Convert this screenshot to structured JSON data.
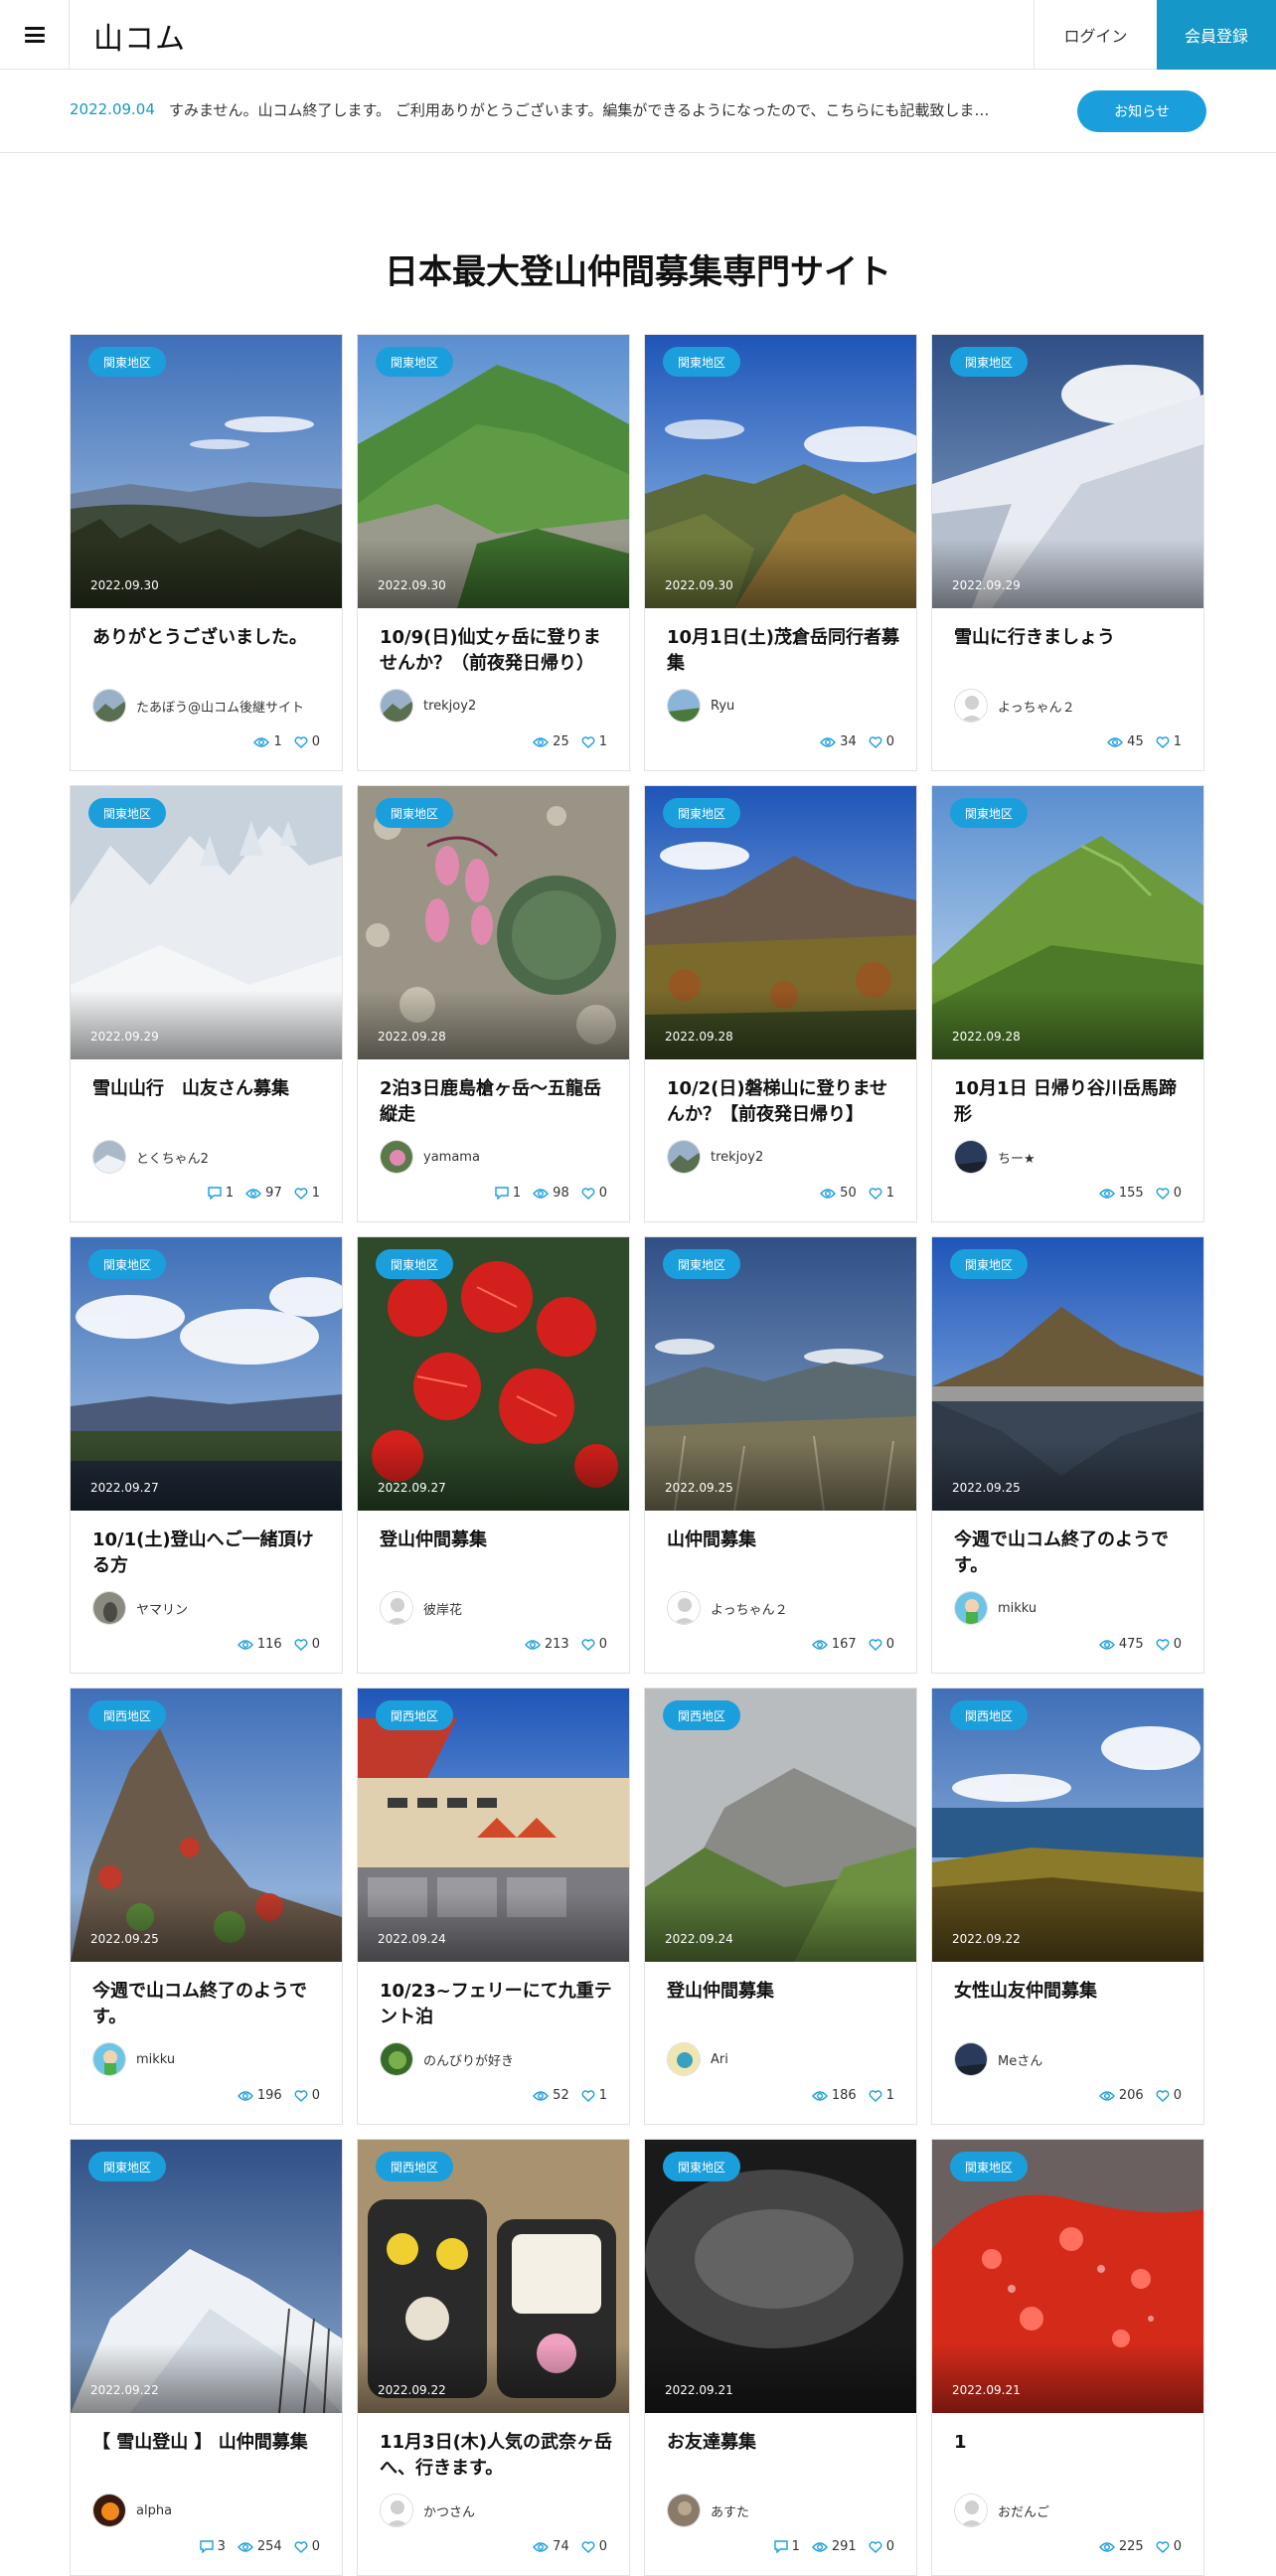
{
  "header": {
    "logo": "山コム",
    "login": "ログイン",
    "register": "会員登録"
  },
  "notice": {
    "date": "2022.09.04",
    "text": "すみません。山コム終了します。 ご利用ありがとうございます。編集ができるようになったので、こちらにも記載致しま…",
    "button": "お知らせ"
  },
  "site_title": "日本最大登山仲間募集専門サイト",
  "colors": {
    "accent": "#1598c8",
    "badge": "#1b9fdc"
  },
  "posts": [
    {
      "region": "関東地区",
      "date": "2022.09.30",
      "title": "ありがとうございました。",
      "author": "たあぼう@山コム後継サイト",
      "comments": "",
      "views": "1",
      "likes": "0",
      "scene": "sky-forest",
      "avatar": "mountain"
    },
    {
      "region": "関東地区",
      "date": "2022.09.30",
      "title": "10/9(日)仙丈ヶ岳に登りませんか？（前夜発日帰り）",
      "author": "trekjoy2",
      "comments": "",
      "views": "25",
      "likes": "1",
      "scene": "green-ridge",
      "avatar": "mountain"
    },
    {
      "region": "関東地区",
      "date": "2022.09.30",
      "title": "10月1日(土)茂倉岳同行者募集",
      "author": "Ryu",
      "comments": "",
      "views": "34",
      "likes": "0",
      "scene": "autumn-ridge",
      "avatar": "green"
    },
    {
      "region": "関東地区",
      "date": "2022.09.29",
      "title": "雪山に行きましょう",
      "author": "よっちゃん２",
      "comments": "",
      "views": "45",
      "likes": "1",
      "scene": "snow-slope",
      "avatar": "default"
    },
    {
      "region": "関東地区",
      "date": "2022.09.29",
      "title": "雪山山行　山友さん募集",
      "author": "とくちゃん2",
      "comments": "1",
      "views": "97",
      "likes": "1",
      "scene": "snow-trees",
      "avatar": "snow"
    },
    {
      "region": "関東地区",
      "date": "2022.09.28",
      "title": "2泊3日鹿島槍ヶ岳〜五龍岳縦走",
      "author": "yamama",
      "comments": "1",
      "views": "98",
      "likes": "0",
      "scene": "flower-pink",
      "avatar": "flower"
    },
    {
      "region": "関東地区",
      "date": "2022.09.28",
      "title": "10/2(日)磐梯山に登りませんか？【前夜発日帰り】",
      "author": "trekjoy2",
      "comments": "",
      "views": "50",
      "likes": "1",
      "scene": "volcano-autumn",
      "avatar": "mountain"
    },
    {
      "region": "関東地区",
      "date": "2022.09.28",
      "title": "10月1日 日帰り谷川岳馬蹄形",
      "author": "ちー★",
      "comments": "",
      "views": "155",
      "likes": "0",
      "scene": "green-hill",
      "avatar": "dark"
    },
    {
      "region": "関東地区",
      "date": "2022.09.27",
      "title": "10/1(土)登山へご一緒頂ける方",
      "author": "ヤマリン",
      "comments": "",
      "views": "116",
      "likes": "0",
      "scene": "clouds-lake",
      "avatar": "gray"
    },
    {
      "region": "関東地区",
      "date": "2022.09.27",
      "title": "登山仲間募集",
      "author": "彼岸花",
      "comments": "",
      "views": "213",
      "likes": "0",
      "scene": "red-flower",
      "avatar": "default"
    },
    {
      "region": "関東地区",
      "date": "2022.09.25",
      "title": "山仲間募集",
      "author": "よっちゃん２",
      "comments": "",
      "views": "167",
      "likes": "0",
      "scene": "blue-hills",
      "avatar": "default"
    },
    {
      "region": "関東地区",
      "date": "2022.09.25",
      "title": "今週で山コム終了のようです。",
      "author": "mikku",
      "comments": "",
      "views": "475",
      "likes": "0",
      "scene": "lake-volcano",
      "avatar": "character"
    },
    {
      "region": "関西地区",
      "date": "2022.09.25",
      "title": "今週で山コム終了のようです。",
      "author": "mikku",
      "comments": "",
      "views": "196",
      "likes": "0",
      "scene": "rocky-autumn",
      "avatar": "character"
    },
    {
      "region": "関西地区",
      "date": "2022.09.24",
      "title": "10/23~フェリーにて九重テント泊",
      "author": "のんびりが好き",
      "comments": "",
      "views": "52",
      "likes": "1",
      "scene": "ferry",
      "avatar": "leaf"
    },
    {
      "region": "関西地区",
      "date": "2022.09.24",
      "title": "登山仲間募集",
      "author": "Ari",
      "comments": "",
      "views": "186",
      "likes": "1",
      "scene": "misty-slope",
      "avatar": "cartoon"
    },
    {
      "region": "関西地区",
      "date": "2022.09.22",
      "title": "女性山友仲間募集",
      "author": "Meさん",
      "comments": "",
      "views": "206",
      "likes": "0",
      "scene": "sea-cliff",
      "avatar": "dark"
    },
    {
      "region": "関東地区",
      "date": "2022.09.22",
      "title": "【 雪山登山 】 山仲間募集",
      "author": "alpha",
      "comments": "3",
      "views": "254",
      "likes": "0",
      "scene": "snow-peak",
      "avatar": "sunset"
    },
    {
      "region": "関西地区",
      "date": "2022.09.22",
      "title": "11月3日(木)人気の武奈ヶ岳へ、行きます。",
      "author": "かつさん",
      "comments": "",
      "views": "74",
      "likes": "0",
      "scene": "bento",
      "avatar": "default"
    },
    {
      "region": "関東地区",
      "date": "2022.09.21",
      "title": "お友達募集",
      "author": "あすた",
      "comments": "1",
      "views": "291",
      "likes": "0",
      "scene": "dark-snow",
      "avatar": "brown"
    },
    {
      "region": "関東地区",
      "date": "2022.09.21",
      "title": "1",
      "author": "おだんご",
      "comments": "",
      "views": "225",
      "likes": "0",
      "scene": "red-ice",
      "avatar": "default"
    }
  ]
}
